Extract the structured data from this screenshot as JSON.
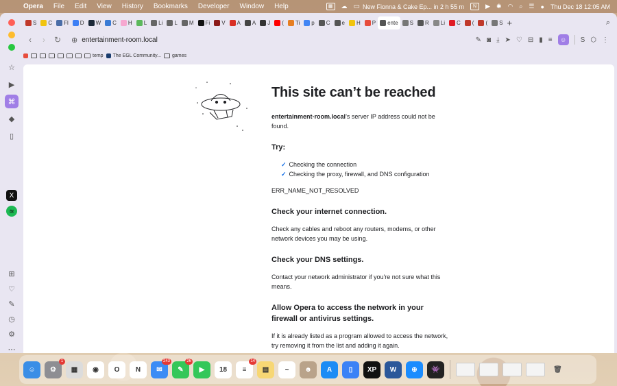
{
  "menubar": {
    "app": "Opera",
    "items": [
      "File",
      "Edit",
      "View",
      "History",
      "Bookmarks",
      "Developer",
      "Window",
      "Help"
    ],
    "media_title": "New Fionna & Cake Ep... in 2 h 55 m",
    "clock": "Thu Dec 18  12:05 AM"
  },
  "tabs": [
    {
      "label": "S",
      "color": "#c0392b"
    },
    {
      "label": "C",
      "color": "#f1c40f"
    },
    {
      "label": "Fl",
      "color": "#4a6da7"
    },
    {
      "label": "D",
      "color": "#3d7ff5"
    },
    {
      "label": "W",
      "color": "#1b2838"
    },
    {
      "label": "C",
      "color": "#3a7bd5"
    },
    {
      "label": "H",
      "color": "#f6a8d0"
    },
    {
      "label": "L",
      "color": "#5cb85c"
    },
    {
      "label": "Li",
      "color": "#666666"
    },
    {
      "label": "L",
      "color": "#666666"
    },
    {
      "label": "M",
      "color": "#666666"
    },
    {
      "label": "Fi",
      "color": "#111111"
    },
    {
      "label": "V",
      "color": "#8b1a1a"
    },
    {
      "label": "A",
      "color": "#d93025"
    },
    {
      "label": "A",
      "color": "#444444"
    },
    {
      "label": "J",
      "color": "#333333"
    },
    {
      "label": "(",
      "color": "#ff0000"
    },
    {
      "label": "Ti",
      "color": "#e67e22"
    },
    {
      "label": "p",
      "color": "#4285f4"
    },
    {
      "label": "C",
      "color": "#555555"
    },
    {
      "label": "e",
      "color": "#555555"
    },
    {
      "label": "H",
      "color": "#f1c40f"
    },
    {
      "label": "P",
      "color": "#e74c3c"
    },
    {
      "label": "ente",
      "color": "#555555",
      "active": true
    },
    {
      "label": "S",
      "color": "#777777"
    },
    {
      "label": "R",
      "color": "#555555"
    },
    {
      "label": "Li",
      "color": "#888888"
    },
    {
      "label": "C",
      "color": "#e01b24"
    },
    {
      "label": "(",
      "color": "#c0392b"
    },
    {
      "label": "(",
      "color": "#c0392b"
    },
    {
      "label": "S",
      "color": "#777777"
    }
  ],
  "addressbar": {
    "url": "entertainment-room.local"
  },
  "bookmarks": [
    {
      "label": "",
      "kind": "mini",
      "color": "#e74c3c"
    },
    {
      "label": "",
      "kind": "folder"
    },
    {
      "label": "",
      "kind": "folder"
    },
    {
      "label": "",
      "kind": "folder"
    },
    {
      "label": "",
      "kind": "folder"
    },
    {
      "label": "",
      "kind": "folder"
    },
    {
      "label": "",
      "kind": "folder"
    },
    {
      "label": "temp",
      "kind": "folder"
    },
    {
      "label": "The EGL Community...",
      "kind": "mini",
      "color": "#1a3c6e"
    },
    {
      "label": "games",
      "kind": "folder"
    }
  ],
  "error": {
    "title": "This site can’t be reached",
    "host": "entertainment-room.local",
    "host_suffix": "’s server IP address could not be found.",
    "try_heading": "Try:",
    "suggestions": [
      "Checking the connection",
      "Checking the proxy, firewall, and DNS configuration"
    ],
    "code": "ERR_NAME_NOT_RESOLVED",
    "sections": [
      {
        "heading": "Check your internet connection.",
        "body": "Check any cables and reboot any routers, modems, or other network devices you may be using."
      },
      {
        "heading": "Check your DNS settings.",
        "body": "Contact your network administrator if you're not sure what this means."
      },
      {
        "heading": "Allow Opera to access the network in your firewall or antivirus settings.",
        "body": "If it is already listed as a program allowed to access the network, try removing it from the list and adding it again."
      }
    ]
  },
  "dock": [
    {
      "name": "finder-icon",
      "color": "#3a8ee6",
      "glyph": "☺"
    },
    {
      "name": "system-settings-icon",
      "color": "#8e8e93",
      "glyph": "⚙",
      "badge": "1"
    },
    {
      "name": "launchpad-icon",
      "color": "#dcdcdc",
      "glyph": "▦"
    },
    {
      "name": "chrome-icon",
      "color": "#ffffff",
      "glyph": "◉"
    },
    {
      "name": "opera-icon",
      "color": "#ffffff",
      "glyph": "O"
    },
    {
      "name": "notion-icon",
      "color": "#ffffff",
      "glyph": "N"
    },
    {
      "name": "mail-icon",
      "color": "#3b8cf5",
      "glyph": "✉",
      "badge": "243"
    },
    {
      "name": "messages-icon",
      "color": "#34c759",
      "glyph": "✎",
      "badge": "26"
    },
    {
      "name": "facetime-icon",
      "color": "#34c759",
      "glyph": "▶"
    },
    {
      "name": "calendar-icon",
      "color": "#ffffff",
      "glyph": "18"
    },
    {
      "name": "reminders-icon",
      "color": "#ffffff",
      "glyph": "≡",
      "badge": "14"
    },
    {
      "name": "notes-icon",
      "color": "#f7d774",
      "glyph": "▤"
    },
    {
      "name": "freeform-icon",
      "color": "#ffffff",
      "glyph": "~"
    },
    {
      "name": "contacts-icon",
      "color": "#b9a38a",
      "glyph": "☻"
    },
    {
      "name": "app-store-icon",
      "color": "#1c8cf5",
      "glyph": "A"
    },
    {
      "name": "simulator-icon",
      "color": "#3b82f6",
      "glyph": "▯"
    },
    {
      "name": "xppen-icon",
      "color": "#111111",
      "glyph": "XP"
    },
    {
      "name": "word-icon",
      "color": "#2b579a",
      "glyph": "W"
    },
    {
      "name": "safari-icon",
      "color": "#1a8cff",
      "glyph": "⊕"
    },
    {
      "name": "game-icon",
      "color": "#222222",
      "glyph": "👾"
    }
  ]
}
